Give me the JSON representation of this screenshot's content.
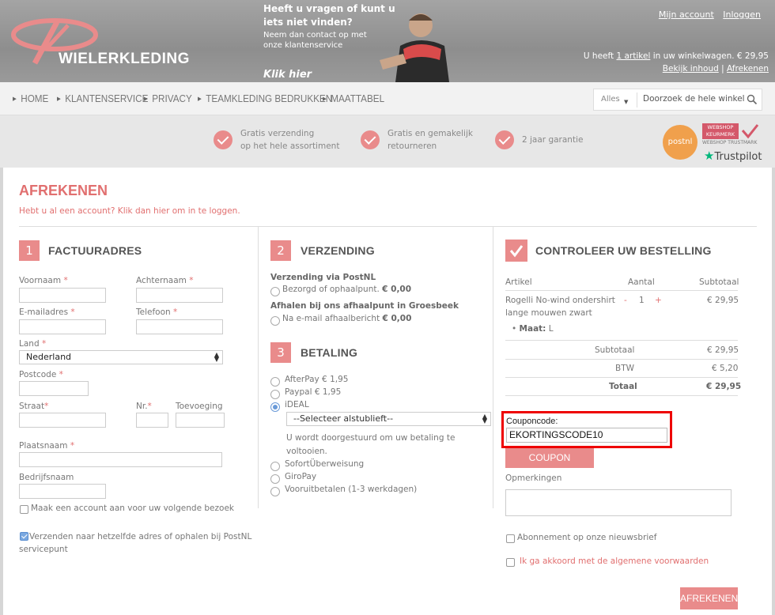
{
  "header": {
    "logo_text": "WIELERKLEDING",
    "promo_title": "Heeft u vragen of kunt u iets niet vinden?",
    "promo_sub": "Neem dan contact op met onze klantenservice",
    "promo_link": "Klik hier",
    "account": {
      "my_account": "Mijn account",
      "login": "Inloggen"
    },
    "cart": {
      "prefix": "U heeft",
      "count": "1 artikel",
      "suffix": "in uw winkelwagen. € 29,95",
      "view": "Bekijk inhoud",
      "separator": "|",
      "checkout": "Afrekenen"
    }
  },
  "nav": {
    "items": [
      "HOME",
      "KLANTENSERVICE",
      "PRIVACY",
      "TEAMKLEDING BEDRUKKEN",
      "MAATTABEL"
    ],
    "search_category": "Alles",
    "search_placeholder": "Doorzoek de hele winkel"
  },
  "usp": [
    {
      "line1": "Gratis verzending",
      "line2": "op het hele assortiment"
    },
    {
      "line1": "Gratis en gemakelijk",
      "line2": "retourneren"
    },
    {
      "line1": "2 jaar garantie",
      "line2": ""
    }
  ],
  "badges": {
    "postnl": "postnl",
    "keurmerk1": "WEBSHOP",
    "keurmerk2": "KEURMERK",
    "keurmerk3": "WEBSHOP TRUSTMARK",
    "trustpilot": "Trustpilot"
  },
  "page": {
    "title": "AFREKENEN",
    "login_hint": "Hebt u al een account? Klik dan hier om in te loggen."
  },
  "billing": {
    "num": "1",
    "title": "FACTUURADRES",
    "first_name": "Voornaam",
    "last_name": "Achternaam",
    "email": "E-mailadres",
    "phone": "Telefoon",
    "country_label": "Land",
    "country_value": "Nederland",
    "postcode": "Postcode",
    "street": "Straat",
    "number": "Nr.",
    "addition": "Toevoeging",
    "city": "Plaatsnaam",
    "company": "Bedrijfsnaam",
    "create_account": "Maak een account aan voor uw volgende bezoek",
    "ship_same": "Verzenden naar hetzelfde adres of ophalen bij PostNL servicepunt",
    "required_mark": "*"
  },
  "shipping": {
    "num": "2",
    "title": "VERZENDING",
    "group1_title": "Verzending via PostNL",
    "group1_option": "Bezorgd of ophaalpunt.",
    "group1_price": "€ 0,00",
    "group2_title": "Afhalen bij ons afhaalpunt in Groesbeek",
    "group2_option": "Na e-mail afhaalbericht",
    "group2_price": "€ 0,00"
  },
  "payment": {
    "num": "3",
    "title": "BETALING",
    "options": [
      "AfterPay € 1,95",
      "Paypal € 1,95",
      "iDEAL",
      "SofortÜberweisung",
      "GiroPay",
      "Vooruitbetalen (1-3 werkdagen)"
    ],
    "selected": "iDEAL",
    "bank_select": "--Selecteer alstublieft--",
    "redirect_note_1": "U wordt doorgestuurd om uw betaling te",
    "redirect_note_2": "voltooien."
  },
  "review": {
    "title": "CONTROLEER UW BESTELLING",
    "col_article": "Artikel",
    "col_qty": "Aantal",
    "col_subtotal": "Subtotaal",
    "item_name_1": "Rogelli No-wind ondershirt",
    "item_name_2": "lange mouwen zwart",
    "item_minus": "-",
    "item_qty": "1",
    "item_plus": "+",
    "item_price": "€ 29,95",
    "option_label": "Maat:",
    "option_value": "L",
    "subtotal_label": "Subtotaal",
    "subtotal_value": "€ 29,95",
    "tax_label": "BTW",
    "tax_value": "€ 5,20",
    "total_label": "Totaal",
    "total_value": "€ 29,95",
    "coupon_label": "Couponcode:",
    "coupon_value": "EKORTINGSCODE10",
    "coupon_button": "COUPON GEBRUIKEN",
    "remarks_label": "Opmerkingen",
    "newsletter": "Abonnement op onze nieuwsbrief",
    "terms": "Ik ga akkoord met de algemene voorwaarden",
    "submit": "AFREKENEN"
  },
  "colors": {
    "accent": "#e98b8b",
    "title": "#e16f6f",
    "highlight": "#e00000"
  }
}
